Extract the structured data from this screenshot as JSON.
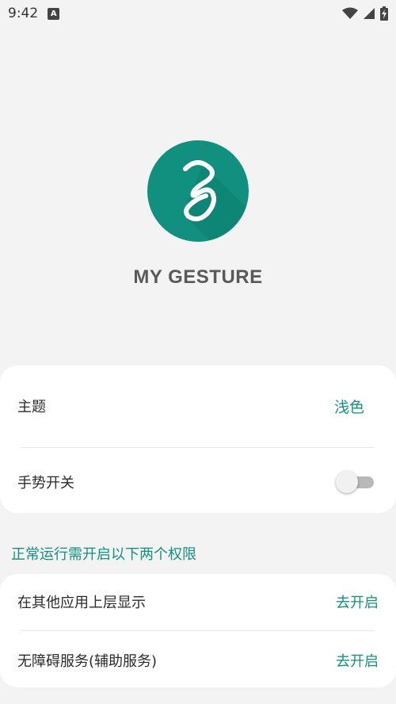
{
  "status_bar": {
    "time": "9:42",
    "notification_icon": "a-letter-icon",
    "icons": [
      "wifi-icon",
      "signal-icon",
      "battery-charging-icon"
    ]
  },
  "app": {
    "title": "MY GESTURE",
    "logo_icon": "gesture-squiggle-icon",
    "brand_color": "#11907f"
  },
  "settings": {
    "theme_label": "主题",
    "theme_value": "浅色",
    "gesture_switch_label": "手势开关",
    "gesture_switch_on": false
  },
  "permissions": {
    "section_title": "正常运行需开启以下两个权限",
    "items": [
      {
        "label": "在其他应用上层显示",
        "action": "去开启"
      },
      {
        "label": "无障碍服务(辅助服务)",
        "action": "去开启"
      }
    ]
  },
  "colors": {
    "accent": "#13917f",
    "background": "#f3f3f3",
    "card": "#ffffff"
  }
}
